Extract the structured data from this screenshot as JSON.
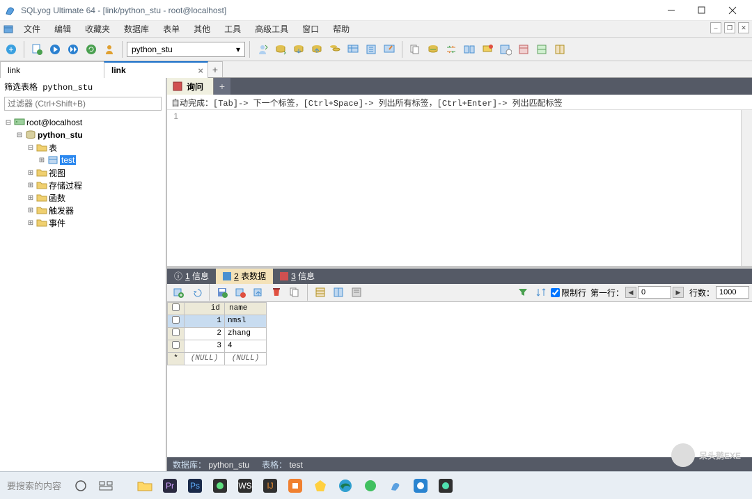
{
  "window": {
    "title": "SQLyog Ultimate 64 - [link/python_stu - root@localhost]"
  },
  "menu": {
    "items": [
      "文件",
      "编辑",
      "收藏夹",
      "数据库",
      "表单",
      "其他",
      "工具",
      "高级工具",
      "窗口",
      "帮助"
    ]
  },
  "toolbar": {
    "db_selected": "python_stu"
  },
  "conn_tabs": {
    "tab1": "link",
    "tab2": "link"
  },
  "left": {
    "filter_title": "筛选表格 python_stu",
    "filter_placeholder": "过滤器 (Ctrl+Shift+B)",
    "tree": {
      "root": "root@localhost",
      "db": "python_stu",
      "folders": {
        "tables": "表",
        "table_item": "test",
        "views": "视图",
        "procs": "存储过程",
        "funcs": "函数",
        "triggers": "触发器",
        "events": "事件"
      }
    }
  },
  "query": {
    "tab_label": "询问",
    "hint": "自动完成：[Tab]-> 下一个标签，[Ctrl+Space]-> 列出所有标签，[Ctrl+Enter]-> 列出匹配标签",
    "line1": "1"
  },
  "result_tabs": {
    "info": "1 信息",
    "data": "2 表数据",
    "msg": "3 信息"
  },
  "result_toolbar": {
    "limit_label": "限制行",
    "firstrow_label": "第一行：",
    "firstrow_value": "0",
    "rowcount_label": "行数：",
    "rowcount_value": "1000"
  },
  "grid": {
    "columns": {
      "id": "id",
      "name": "name"
    },
    "rows": [
      {
        "id": "1",
        "name": "nmsl"
      },
      {
        "id": "2",
        "name": "zhang"
      },
      {
        "id": "3",
        "name": "4"
      }
    ],
    "null_text": "(NULL)"
  },
  "rstatus": {
    "db_lbl": "数据库：",
    "db_val": "python_stu",
    "tbl_lbl": "表格：",
    "tbl_val": "test"
  },
  "taskbar": {
    "search": "要搜索的内容"
  },
  "watermark": {
    "text": "呆头鹅EXE"
  }
}
